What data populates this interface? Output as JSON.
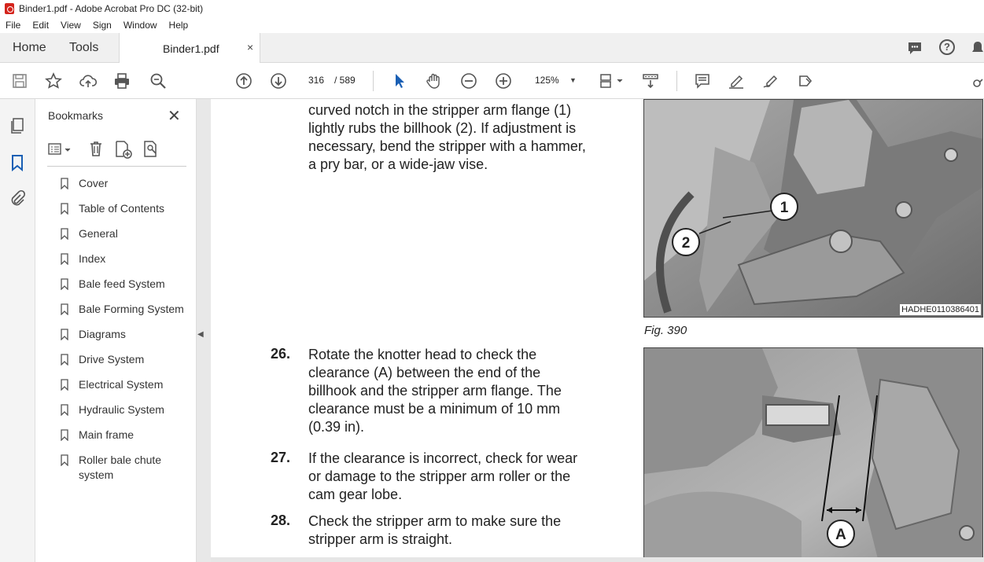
{
  "window": {
    "title": "Binder1.pdf - Adobe Acrobat Pro DC (32-bit)"
  },
  "menu": [
    "File",
    "Edit",
    "View",
    "Sign",
    "Window",
    "Help"
  ],
  "tabs": {
    "home": "Home",
    "tools": "Tools",
    "document": "Binder1.pdf",
    "close": "×"
  },
  "toolbar": {
    "page_current": "316",
    "page_total": "/ 589",
    "zoom": "125%"
  },
  "panel": {
    "title": "Bookmarks",
    "items": [
      "Cover",
      "Table of Contents",
      "General",
      "Index",
      "Bale feed System",
      "Bale Forming System",
      "Diagrams",
      "Drive System",
      "Electrical System",
      "Hydraulic System",
      "Main frame",
      "Roller bale chute system"
    ]
  },
  "document": {
    "top_lines": [
      "curved notch in the stripper arm flange (1)",
      "lightly rubs the billhook (2). If adjustment is",
      "necessary, bend the stripper with a hammer,",
      "a pry bar, or a wide-jaw vise."
    ],
    "steps": [
      {
        "num": "26.",
        "lines": [
          "Rotate the knotter head to check the",
          "clearance (A) between the end of the",
          "billhook and the stripper arm flange. The",
          "clearance must be a minimum of 10 mm",
          "(0.39 in)."
        ]
      },
      {
        "num": "27.",
        "lines": [
          "If the clearance is incorrect, check for wear",
          "or damage to the stripper arm roller or the",
          "cam gear lobe."
        ]
      },
      {
        "num": "28.",
        "lines": [
          "Check the stripper arm to make sure the",
          "stripper arm is straight."
        ]
      }
    ],
    "figure1": {
      "id": "HADHE0110386401",
      "caption": "Fig. 390",
      "callouts": [
        "1",
        "2"
      ]
    },
    "figure2": {
      "callouts": [
        "A"
      ]
    }
  }
}
